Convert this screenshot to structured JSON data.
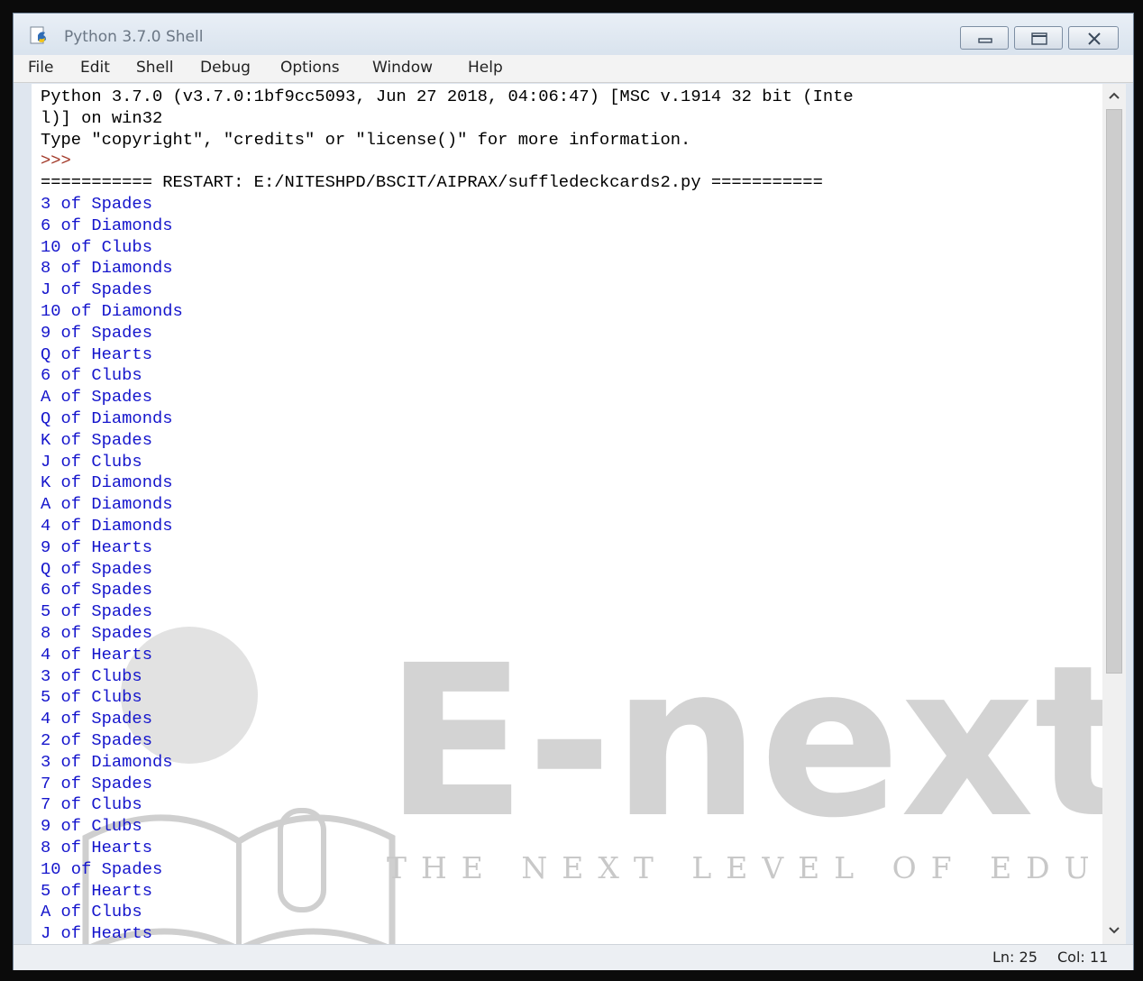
{
  "window": {
    "title": "Python 3.7.0 Shell"
  },
  "menu": [
    "File",
    "Edit",
    "Shell",
    "Debug",
    "Options",
    "Window",
    "Help"
  ],
  "shell_lines": [
    {
      "text": "Python 3.7.0 (v3.7.0:1bf9cc5093, Jun 27 2018, 04:06:47) [MSC v.1914 32 bit (Inte",
      "kind": "sys"
    },
    {
      "text": "l)] on win32",
      "kind": "sys"
    },
    {
      "text": "Type \"copyright\", \"credits\" or \"license()\" for more information.",
      "kind": "sys"
    },
    {
      "text": ">>> ",
      "kind": "prompt"
    },
    {
      "text": "=========== RESTART: E:/NITESHPD/BSCIT/AIPRAX/suffledeckcards2.py ===========",
      "kind": "sys"
    },
    {
      "text": "3 of Spades",
      "kind": "out"
    },
    {
      "text": "6 of Diamonds",
      "kind": "out"
    },
    {
      "text": "10 of Clubs",
      "kind": "out"
    },
    {
      "text": "8 of Diamonds",
      "kind": "out"
    },
    {
      "text": "J of Spades",
      "kind": "out"
    },
    {
      "text": "10 of Diamonds",
      "kind": "out"
    },
    {
      "text": "9 of Spades",
      "kind": "out"
    },
    {
      "text": "Q of Hearts",
      "kind": "out"
    },
    {
      "text": "6 of Clubs",
      "kind": "out"
    },
    {
      "text": "A of Spades",
      "kind": "out"
    },
    {
      "text": "Q of Diamonds",
      "kind": "out"
    },
    {
      "text": "K of Spades",
      "kind": "out"
    },
    {
      "text": "J of Clubs",
      "kind": "out"
    },
    {
      "text": "K of Diamonds",
      "kind": "out"
    },
    {
      "text": "A of Diamonds",
      "kind": "out"
    },
    {
      "text": "4 of Diamonds",
      "kind": "out"
    },
    {
      "text": "9 of Hearts",
      "kind": "out"
    },
    {
      "text": "Q of Spades",
      "kind": "out"
    },
    {
      "text": "6 of Spades",
      "kind": "out"
    },
    {
      "text": "5 of Spades",
      "kind": "out"
    },
    {
      "text": "8 of Spades",
      "kind": "out"
    },
    {
      "text": "4 of Hearts",
      "kind": "out"
    },
    {
      "text": "3 of Clubs",
      "kind": "out"
    },
    {
      "text": "5 of Clubs",
      "kind": "out"
    },
    {
      "text": "4 of Spades",
      "kind": "out"
    },
    {
      "text": "2 of Spades",
      "kind": "out"
    },
    {
      "text": "3 of Diamonds",
      "kind": "out"
    },
    {
      "text": "7 of Spades",
      "kind": "out"
    },
    {
      "text": "7 of Clubs",
      "kind": "out"
    },
    {
      "text": "9 of Clubs",
      "kind": "out"
    },
    {
      "text": "8 of Hearts",
      "kind": "out"
    },
    {
      "text": "10 of Spades",
      "kind": "out"
    },
    {
      "text": "5 of Hearts",
      "kind": "out"
    },
    {
      "text": "A of Clubs",
      "kind": "out"
    },
    {
      "text": "J of Hearts",
      "kind": "out"
    }
  ],
  "watermark": {
    "logo_text": "E-next",
    "tagline": "THE NEXT LEVEL OF EDUCATION"
  },
  "status": {
    "line": "Ln: 25",
    "col": "Col: 11"
  },
  "colors": {
    "output": "#1515cc",
    "prompt": "#a33a2a",
    "text": "#000000",
    "watermark": "#cfcfcf"
  }
}
